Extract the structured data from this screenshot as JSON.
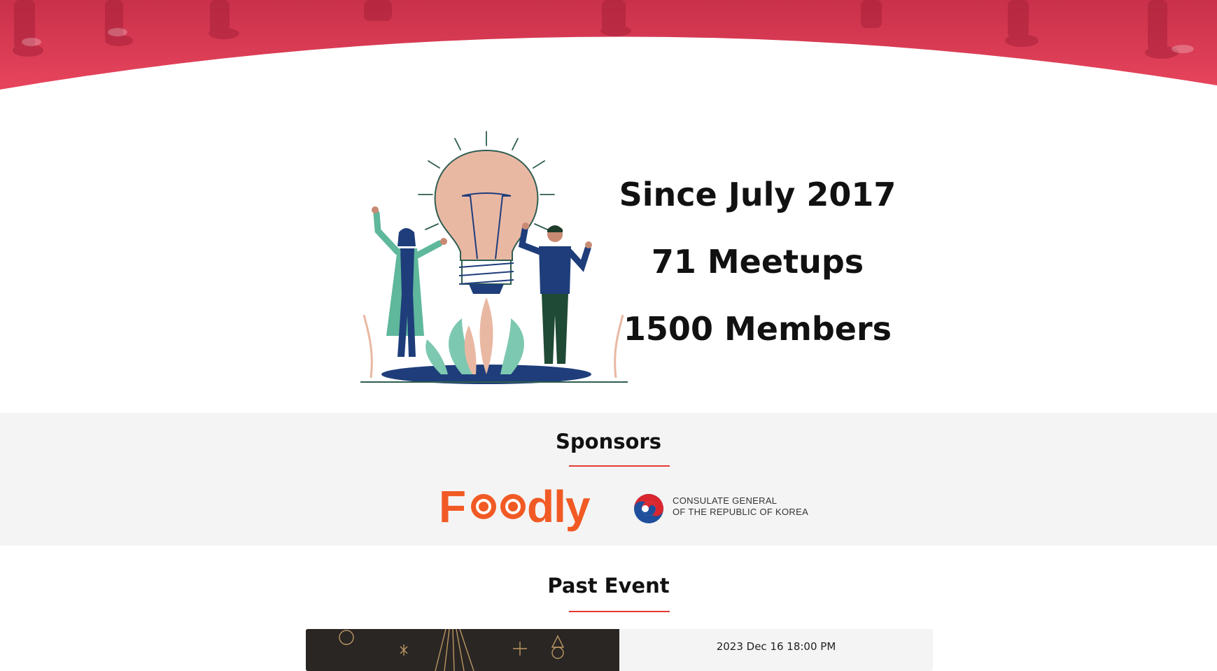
{
  "stats": {
    "since": "Since July 2017",
    "meetups": "71 Meetups",
    "members": "1500 Members"
  },
  "sponsors": {
    "title": "Sponsors",
    "foodly_logo_text": "Foodly",
    "korea_line1": "CONSULATE GENERAL",
    "korea_line2": "OF THE REPUBLIC OF KOREA"
  },
  "past_event": {
    "title": "Past Event",
    "events": [
      {
        "date": "2023 Dec 16 18:00 PM"
      }
    ]
  },
  "colors": {
    "accent_red": "#e53935",
    "hero_pink": "#e9465e",
    "foodly_orange": "#f15a24",
    "section_gray": "#f4f4f4"
  }
}
